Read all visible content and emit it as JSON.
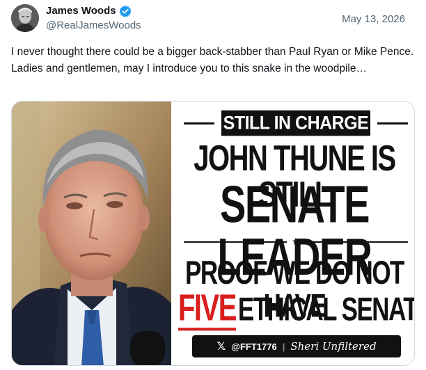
{
  "author": {
    "display_name": "James Woods",
    "handle": "@RealJamesWoods",
    "verified_icon": "verified-badge-icon",
    "verified_color": "#1d9bf0"
  },
  "date": "May 13, 2026",
  "tweet_text": "I never thought there could be a bigger back-stabber than Paul Ryan or Mike Pence. Ladies and gentlemen, may I introduce you to this snake in the woodpile…",
  "media": {
    "banner": "STILL IN CHARGE",
    "line1": "JOHN THUNE IS STILL",
    "line2": "SENATE LEADER",
    "line3": "PROOF WE DO NOT HAVE",
    "line4_highlight": "FIVE",
    "line4_rest": "ETHICAL SENATORS",
    "highlight_color": "#d91e1e",
    "footer_x": "𝕏",
    "footer_handle": "@FFT1776",
    "footer_sep": "|",
    "footer_brand": "Sheri Unfiltered"
  }
}
